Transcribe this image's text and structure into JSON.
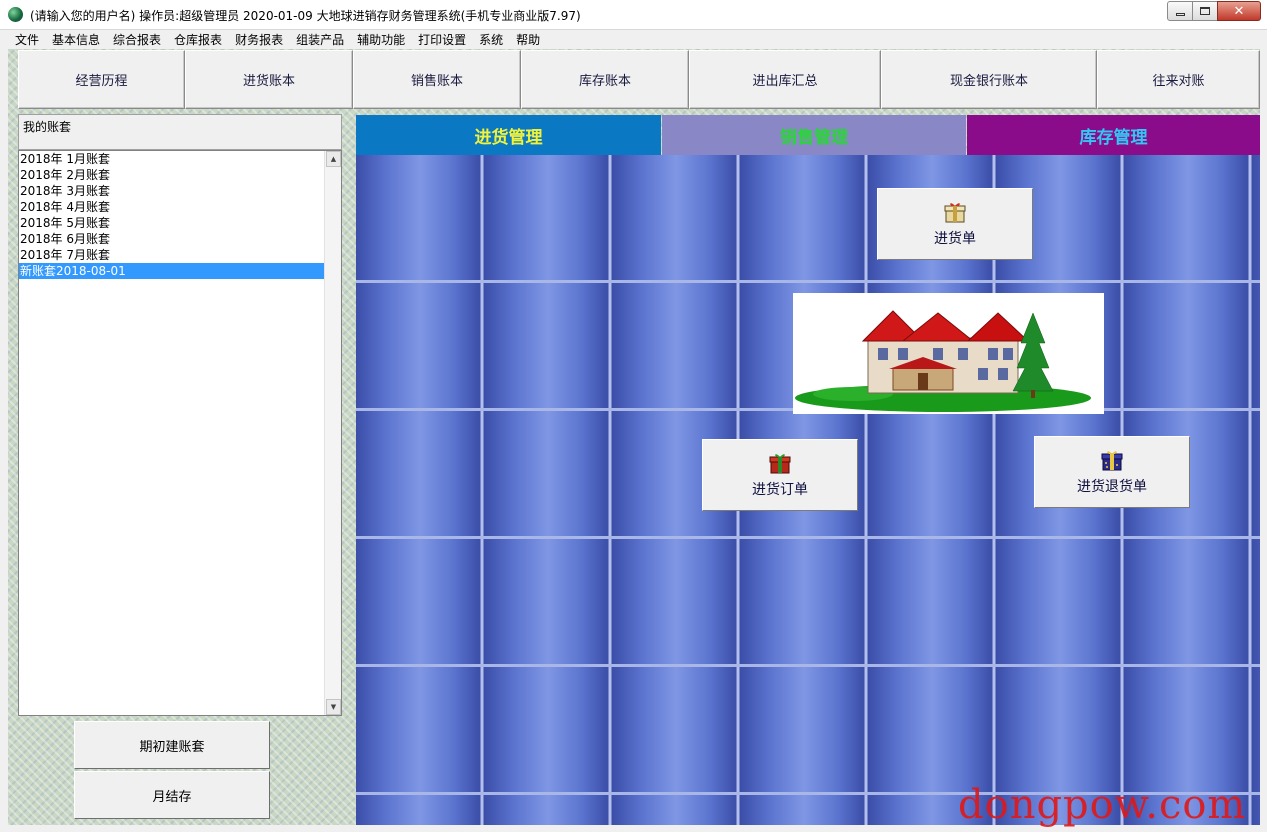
{
  "window": {
    "title": "(请输入您的用户名)  操作员:超级管理员   2020-01-09  大地球进销存财务管理系统(手机专业商业版7.97)"
  },
  "menu": [
    "文件",
    "基本信息",
    "综合报表",
    "仓库报表",
    "财务报表",
    "组装产品",
    "辅助功能",
    "打印设置",
    "系统",
    "帮助"
  ],
  "toolbar": [
    "经营历程",
    "进货账本",
    "销售账本",
    "库存账本",
    "进出库汇总",
    "现金银行账本",
    "往来对账"
  ],
  "accounts": {
    "header": "我的账套",
    "items": [
      "2018年 1月账套",
      "2018年 2月账套",
      "2018年 3月账套",
      "2018年 4月账套",
      "2018年 5月账套",
      "2018年 6月账套",
      "2018年 7月账套",
      "新账套2018-08-01"
    ],
    "selected_index": 7
  },
  "left_buttons": {
    "opening": "期初建账套",
    "monthly": "月结存"
  },
  "tabs": [
    {
      "label": "进货管理",
      "bg": "#0a78c2",
      "fg": "#f2f23a"
    },
    {
      "label": "销售管理",
      "bg": "#8a87c6",
      "fg": "#2bd43b"
    },
    {
      "label": "库存管理",
      "bg": "#8a0c8a",
      "fg": "#33c7f5"
    }
  ],
  "functions": {
    "purchase": "进货单",
    "purchase_order": "进货订单",
    "purchase_return": "进货退货单"
  },
  "watermark": "dongpow.com",
  "icons": {
    "purchase": "gift-box-icon",
    "purchase_order": "red-gift-box-icon",
    "purchase_return": "blue-gift-box-icon"
  }
}
